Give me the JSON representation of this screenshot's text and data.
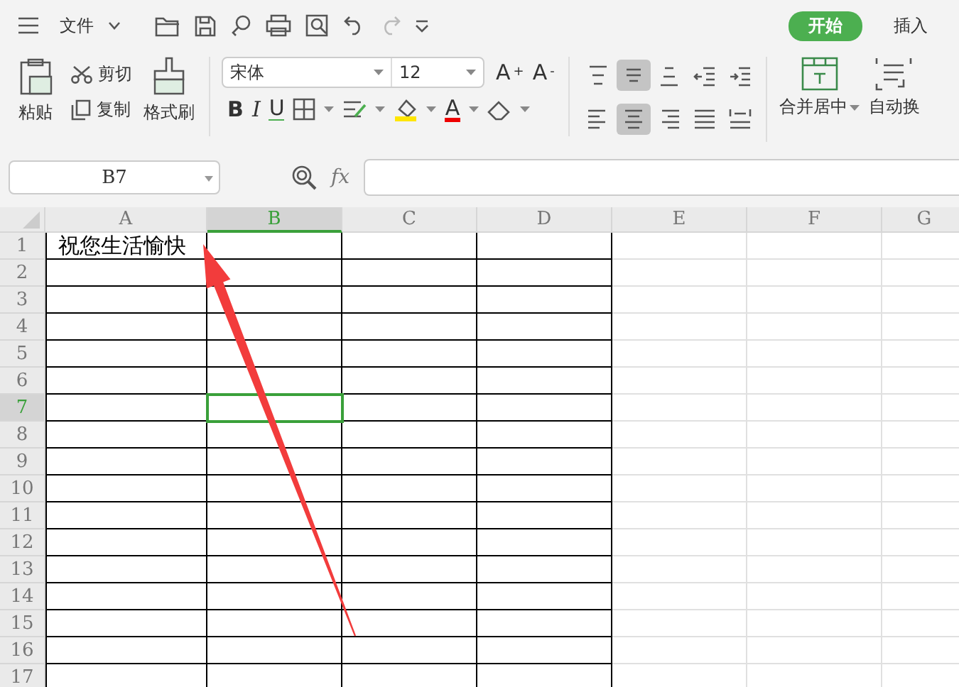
{
  "top_bar": {
    "menu_label": "文件",
    "tabs": [
      {
        "label": "开始",
        "selected": true
      },
      {
        "label": "插入",
        "selected": false
      }
    ]
  },
  "ribbon": {
    "paste": "粘贴",
    "cut": "剪切",
    "copy": "复制",
    "format_painter": "格式刷",
    "font_name": "宋体",
    "font_size": "12",
    "grow_font": "A$^{+}$",
    "shrink_font": "A$^{-}$",
    "bold": "B",
    "italic": "I",
    "underline": "U",
    "font_color": "A",
    "alignment_rows": [
      [
        {
          "selected": false
        },
        {
          "selected": true
        },
        {
          "selected": false
        },
        {
          "selected": false
        },
        {
          "selected": false
        }
      ],
      [
        {
          "selected": false
        },
        {
          "selected": true
        },
        {
          "selected": false
        },
        {
          "selected": false
        },
        {
          "selected": false
        }
      ]
    ],
    "merge": "合并居中",
    "wrap": "自动换"
  },
  "formula_bar": {
    "name_box": "B7",
    "fx": "fx"
  },
  "sheet": {
    "columns": [
      {
        "label": "A",
        "selected": false,
        "bordered": true
      },
      {
        "label": "B",
        "selected": true,
        "bordered": true
      },
      {
        "label": "C",
        "selected": false,
        "bordered": true
      },
      {
        "label": "D",
        "selected": false,
        "bordered": true
      },
      {
        "label": "E",
        "selected": false,
        "bordered": false
      },
      {
        "label": "F",
        "selected": false,
        "bordered": false
      },
      {
        "label": "G",
        "selected": false,
        "bordered": false
      }
    ],
    "rows": [
      {
        "label": "1",
        "selected": false,
        "cells": [
          "祝您生活愉快"
        ]
      },
      {
        "label": "2",
        "selected": false
      },
      {
        "label": "3",
        "selected": false
      },
      {
        "label": "4",
        "selected": false
      },
      {
        "label": "5",
        "selected": false
      },
      {
        "label": "6",
        "selected": false
      },
      {
        "label": "7",
        "selected": true
      },
      {
        "label": "8",
        "selected": false
      },
      {
        "label": "9",
        "selected": false
      },
      {
        "label": "10",
        "selected": false
      },
      {
        "label": "11",
        "selected": false
      },
      {
        "label": "12",
        "selected": false
      },
      {
        "label": "13",
        "selected": false
      },
      {
        "label": "14",
        "selected": false
      },
      {
        "label": "15",
        "selected": false
      },
      {
        "label": "16",
        "selected": false
      },
      {
        "label": "17",
        "selected": false
      }
    ]
  }
}
